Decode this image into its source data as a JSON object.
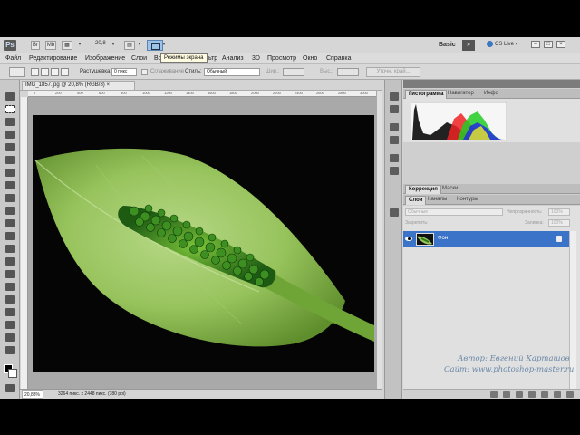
{
  "app": {
    "logo": "Ps",
    "zoom": "20,8",
    "tooltip": "Режимы экрана",
    "workspace": "Basic",
    "workspace_arrow": "»",
    "cs_live": "CS Live",
    "window_buttons": [
      "–",
      "□",
      "×"
    ]
  },
  "menu": [
    "Файл",
    "Редактирование",
    "Изображение",
    "Слои",
    "Выделение",
    "Фильтр",
    "Анализ",
    "3D",
    "Просмотр",
    "Окно",
    "Справка"
  ],
  "menu_hidden_part": "Во",
  "menu_visible_tail": "ильтр",
  "options": {
    "feather_label": "Растушевка:",
    "feather_value": "0 пикс",
    "antialias_label": "Сглаживание",
    "style_label": "Стиль:",
    "style_value": "Обычный",
    "width_label": "Шир.:",
    "height_label": "Выс.:",
    "refine_button": "Уточн. край..."
  },
  "document": {
    "tab_title": "IMG_1857.jpg @ 20,8% (RGB/8)",
    "tab_close": "×",
    "ruler_ticks": [
      "0",
      "200",
      "400",
      "600",
      "800",
      "1000",
      "1200",
      "1400",
      "1600",
      "1800",
      "2000",
      "2200",
      "2400",
      "2600",
      "2800",
      "3000"
    ],
    "status_zoom": "20,83%",
    "status_info": "3264 пикс. x 2448 пикс. (180 ppi)"
  },
  "panels": {
    "top_tabs": [
      "Гистограмма",
      "Навигатор",
      "Инфо"
    ],
    "mid_tabs": [
      "Коррекция",
      "Маски"
    ],
    "layer_tabs": [
      "Слои",
      "Каналы",
      "Контуры"
    ],
    "blend_mode": "Обычные",
    "opacity_label": "Непрозрачность:",
    "opacity_value": "100%",
    "lock_label": "Закрепить:",
    "fill_label": "Заливка:",
    "fill_value": "100%",
    "layer_name": "Фон"
  },
  "watermark": {
    "author": "Автор: Евгений Карташов",
    "site": "Сайт: www.photoshop-master.ru"
  },
  "colors": {
    "accent": "#3a73c8",
    "workspace_bg": "#d4d4d4",
    "canvas_bg": "#a9a9a9"
  }
}
